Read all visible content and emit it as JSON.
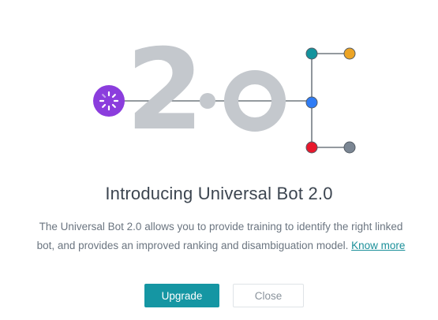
{
  "hero": {
    "version_major": "2",
    "version_minor": "0",
    "nodes": {
      "bot_color": "#8b3ddd",
      "top_left": "#13939d",
      "top_right": "#eca425",
      "center": "#2f7cf5",
      "bottom_left": "#e8182c",
      "bottom_right": "#7b8693"
    },
    "digit_color": "#c4c8cd",
    "line_color": "#555d66",
    "bot_icon": "loading-spinner-icon"
  },
  "dialog": {
    "title": "Introducing Universal Bot 2.0",
    "description": "The Universal Bot 2.0 allows you to provide training to identify the right linked bot, and provides an improved ranking and disambiguation model.",
    "link_label": "Know more"
  },
  "buttons": {
    "upgrade_label": "Upgrade",
    "close_label": "Close"
  },
  "colors": {
    "accent": "#1596a3",
    "link": "#1a8f99"
  }
}
